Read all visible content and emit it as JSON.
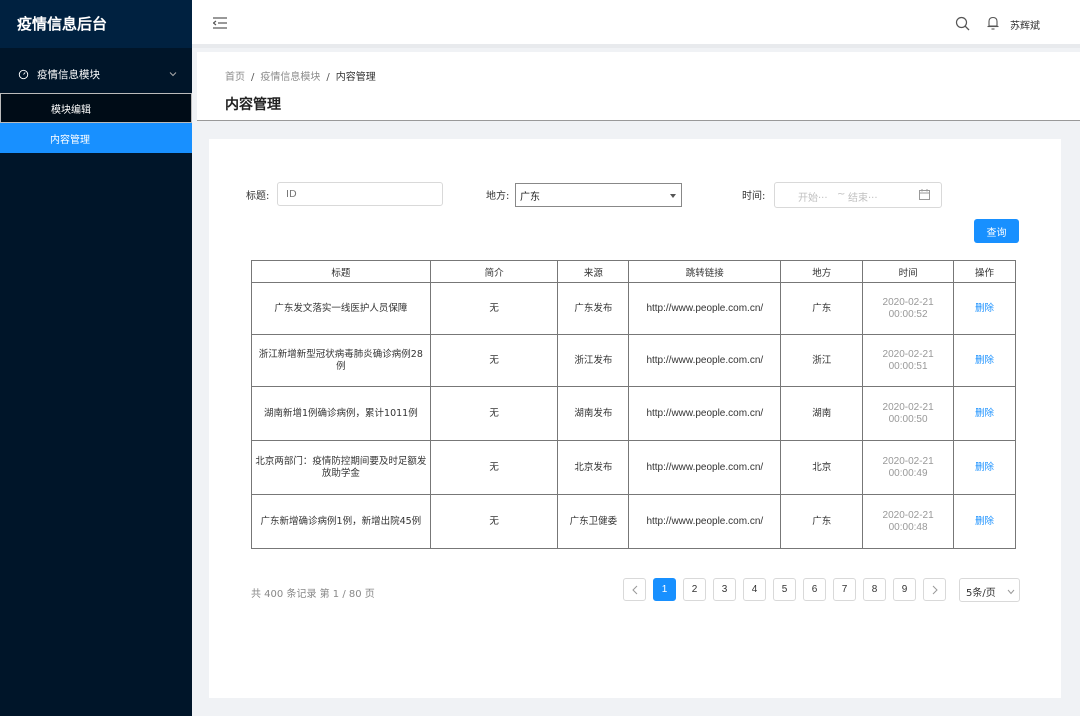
{
  "app": {
    "title": "疫情信息后台"
  },
  "sidebar": {
    "group_label": "疫情信息模块",
    "items": [
      {
        "label": "模块编辑"
      },
      {
        "label": "内容管理"
      }
    ]
  },
  "header": {
    "username": "苏辉斌"
  },
  "breadcrumb": {
    "home": "首页",
    "module": "疫情信息模块",
    "current": "内容管理"
  },
  "page": {
    "title": "内容管理"
  },
  "filters": {
    "title_label": "标题:",
    "title_placeholder": "ID",
    "region_label": "地方:",
    "region_value": "广东",
    "time_label": "时间:",
    "time_start": "开始···",
    "time_sep": "~",
    "time_end": "结束···",
    "query_label": "查询"
  },
  "table": {
    "headers": [
      "标题",
      "简介",
      "来源",
      "跳转链接",
      "地方",
      "时间",
      "操作"
    ],
    "rows": [
      {
        "title": "广东发文落实一线医护人员保障",
        "intro": "无",
        "source": "广东发布",
        "link": "http://www.people.com.cn/",
        "region": "广东",
        "date": "2020-02-21",
        "time": "00:00:52",
        "action": "删除"
      },
      {
        "title": "浙江新增新型冠状病毒肺炎确诊病例28例",
        "intro": "无",
        "source": "浙江发布",
        "link": "http://www.people.com.cn/",
        "region": "浙江",
        "date": "2020-02-21",
        "time": "00:00:51",
        "action": "删除"
      },
      {
        "title": "湖南新增1例确诊病例，累计1011例",
        "intro": "无",
        "source": "湖南发布",
        "link": "http://www.people.com.cn/",
        "region": "湖南",
        "date": "2020-02-21",
        "time": "00:00:50",
        "action": "删除"
      },
      {
        "title": "北京两部门：疫情防控期间要及时足额发放助学金",
        "intro": "无",
        "source": "北京发布",
        "link": "http://www.people.com.cn/",
        "region": "北京",
        "date": "2020-02-21",
        "time": "00:00:49",
        "action": "删除"
      },
      {
        "title": "广东新增确诊病例1例，新增出院45例",
        "intro": "无",
        "source": "广东卫健委",
        "link": "http://www.people.com.cn/",
        "region": "广东",
        "date": "2020-02-21",
        "time": "00:00:48",
        "action": "删除"
      }
    ]
  },
  "pagination": {
    "summary": "共 400 条记录 第 1 / 80 页",
    "pages": [
      "1",
      "2",
      "3",
      "4",
      "5",
      "6",
      "7",
      "8",
      "9"
    ],
    "current": "1",
    "page_size": "5条/页"
  },
  "colors": {
    "sidebar_bg": "#001529",
    "accent": "#1890ff"
  }
}
